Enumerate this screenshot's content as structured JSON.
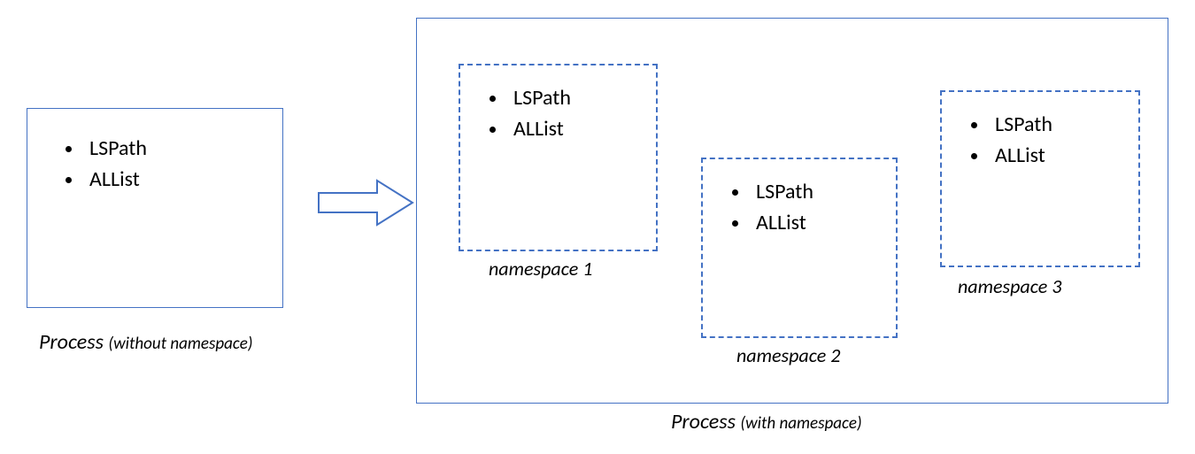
{
  "left_process": {
    "items": [
      "LSPath",
      "ALList"
    ],
    "caption_main": "Process ",
    "caption_sub": "(without namespace)"
  },
  "right_process": {
    "caption_main": "Process ",
    "caption_sub": "(with namespace)"
  },
  "namespaces": [
    {
      "label": "namespace 1",
      "items": [
        "LSPath",
        "ALList"
      ]
    },
    {
      "label": "namespace 2",
      "items": [
        "LSPath",
        "ALList"
      ]
    },
    {
      "label": "namespace 3",
      "items": [
        "LSPath",
        "ALList"
      ]
    }
  ],
  "colors": {
    "border": "#4472c4"
  }
}
